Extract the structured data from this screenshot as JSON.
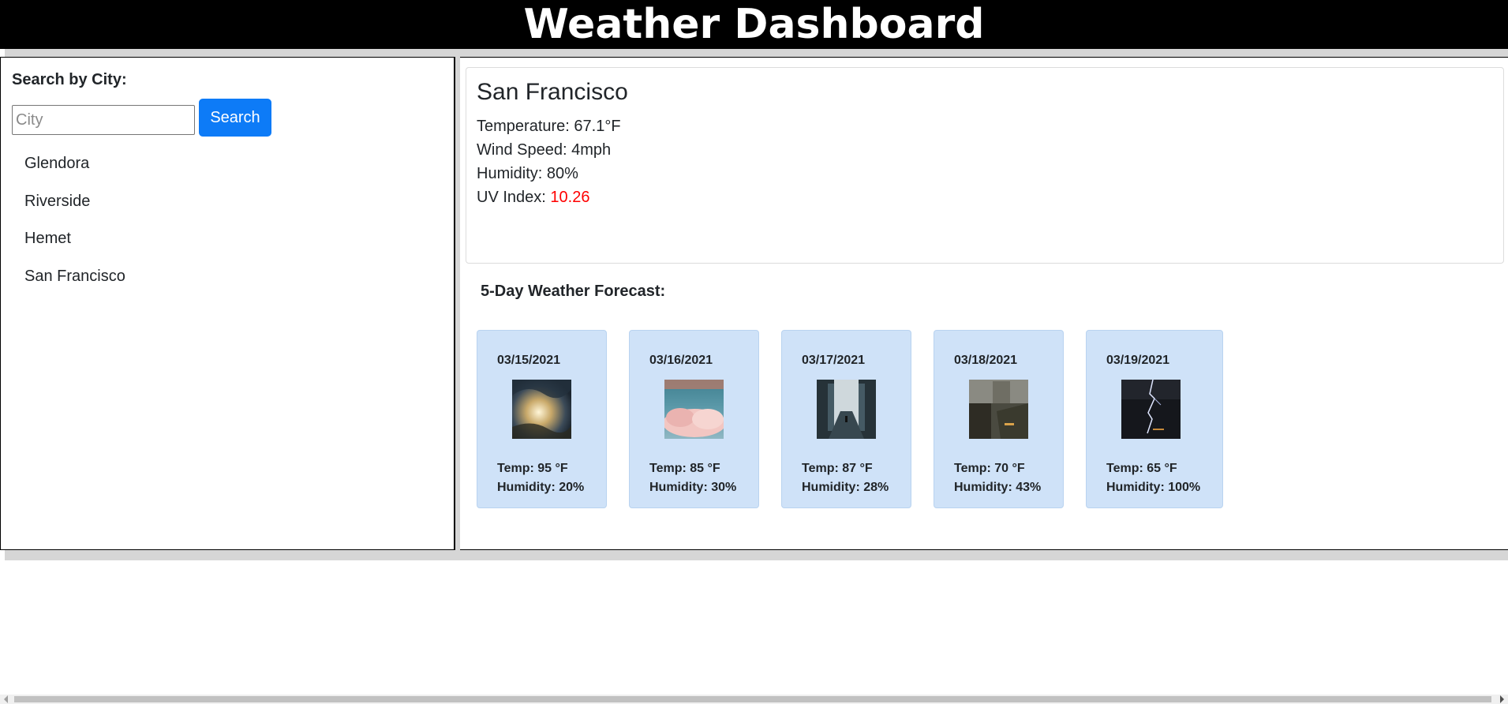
{
  "header": {
    "title": "Weather Dashboard"
  },
  "sidebar": {
    "label": "Search by City:",
    "search_placeholder": "City",
    "search_value": "",
    "search_button": "Search",
    "history": [
      "Glendora",
      "Riverside",
      "Hemet",
      "San Francisco"
    ]
  },
  "current": {
    "city": "San Francisco",
    "temperature_label": "Temperature: ",
    "temperature": "67.1°F",
    "wind_label": "Wind Speed: ",
    "wind": "4mph",
    "humidity_label": "Humidity: ",
    "humidity": "80%",
    "uv_label": "UV Index: ",
    "uv": "10.26",
    "uv_color": "#ff0000"
  },
  "forecast": {
    "title": "5-Day Weather Forecast:",
    "days": [
      {
        "date": "03/15/2021",
        "temp": "Temp: 95 °F",
        "humidity": "Humidity: 20%",
        "icon": "sun-rays-through-clouds-image"
      },
      {
        "date": "03/16/2021",
        "temp": "Temp: 85 °F",
        "humidity": "Humidity: 30%",
        "icon": "pink-clouds-image"
      },
      {
        "date": "03/17/2021",
        "temp": "Temp: 87 °F",
        "humidity": "Humidity: 28%",
        "icon": "snowy-road-image"
      },
      {
        "date": "03/18/2021",
        "temp": "Temp: 70 °F",
        "humidity": "Humidity: 43%",
        "icon": "rainy-city-street-image"
      },
      {
        "date": "03/19/2021",
        "temp": "Temp: 65 °F",
        "humidity": "Humidity: 100%",
        "icon": "lightning-storm-image"
      }
    ]
  },
  "colors": {
    "header_bg": "#000000",
    "button_bg": "#0d7bf7",
    "card_bg": "#cfe2f8",
    "uv_high": "#ff0000"
  }
}
